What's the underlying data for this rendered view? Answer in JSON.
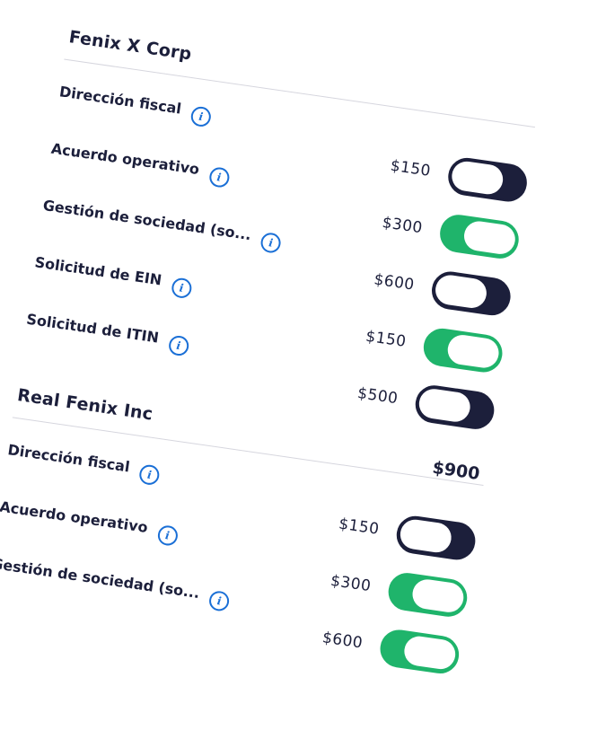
{
  "sections": [
    {
      "company": "Fenix X Corp",
      "total": "",
      "items": [
        {
          "label": "Dirección fiscal",
          "price": "$150",
          "enabled": false
        },
        {
          "label": "Acuerdo operativo",
          "price": "$300",
          "enabled": true
        },
        {
          "label": "Gestión de sociedad (so...",
          "price": "$600",
          "enabled": false
        },
        {
          "label": "Solicitud de EIN",
          "price": "$150",
          "enabled": true
        },
        {
          "label": "Solicitud de ITIN",
          "price": "$500",
          "enabled": false
        }
      ]
    },
    {
      "company": "Real Fenix Inc",
      "total": "$900",
      "items": [
        {
          "label": "Dirección fiscal",
          "price": "$150",
          "enabled": false
        },
        {
          "label": "Acuerdo operativo",
          "price": "$300",
          "enabled": true
        },
        {
          "label": "Gestión de sociedad (so...",
          "price": "$600",
          "enabled": true
        }
      ]
    }
  ],
  "icons": {
    "info": "info-icon"
  },
  "colors": {
    "text": "#1c1f3b",
    "toggle_on": "#1fb46b",
    "toggle_off": "#1c1f3b",
    "info_icon": "#1a6fd6",
    "divider": "#d6d6de"
  }
}
